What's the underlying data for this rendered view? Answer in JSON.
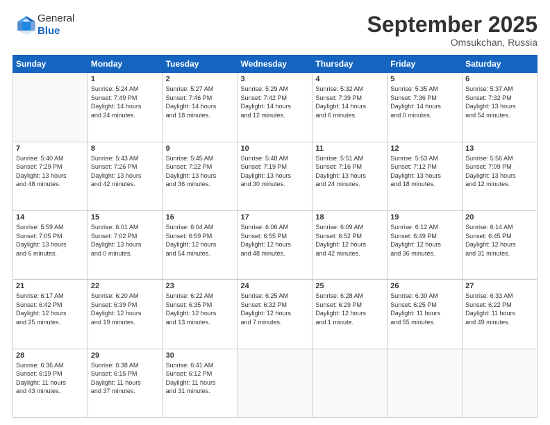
{
  "header": {
    "logo_general": "General",
    "logo_blue": "Blue",
    "month": "September 2025",
    "location": "Omsukchan, Russia"
  },
  "weekdays": [
    "Sunday",
    "Monday",
    "Tuesday",
    "Wednesday",
    "Thursday",
    "Friday",
    "Saturday"
  ],
  "weeks": [
    [
      {
        "day": "",
        "info": ""
      },
      {
        "day": "1",
        "info": "Sunrise: 5:24 AM\nSunset: 7:49 PM\nDaylight: 14 hours\nand 24 minutes."
      },
      {
        "day": "2",
        "info": "Sunrise: 5:27 AM\nSunset: 7:46 PM\nDaylight: 14 hours\nand 18 minutes."
      },
      {
        "day": "3",
        "info": "Sunrise: 5:29 AM\nSunset: 7:42 PM\nDaylight: 14 hours\nand 12 minutes."
      },
      {
        "day": "4",
        "info": "Sunrise: 5:32 AM\nSunset: 7:39 PM\nDaylight: 14 hours\nand 6 minutes."
      },
      {
        "day": "5",
        "info": "Sunrise: 5:35 AM\nSunset: 7:36 PM\nDaylight: 14 hours\nand 0 minutes."
      },
      {
        "day": "6",
        "info": "Sunrise: 5:37 AM\nSunset: 7:32 PM\nDaylight: 13 hours\nand 54 minutes."
      }
    ],
    [
      {
        "day": "7",
        "info": "Sunrise: 5:40 AM\nSunset: 7:29 PM\nDaylight: 13 hours\nand 48 minutes."
      },
      {
        "day": "8",
        "info": "Sunrise: 5:43 AM\nSunset: 7:26 PM\nDaylight: 13 hours\nand 42 minutes."
      },
      {
        "day": "9",
        "info": "Sunrise: 5:45 AM\nSunset: 7:22 PM\nDaylight: 13 hours\nand 36 minutes."
      },
      {
        "day": "10",
        "info": "Sunrise: 5:48 AM\nSunset: 7:19 PM\nDaylight: 13 hours\nand 30 minutes."
      },
      {
        "day": "11",
        "info": "Sunrise: 5:51 AM\nSunset: 7:16 PM\nDaylight: 13 hours\nand 24 minutes."
      },
      {
        "day": "12",
        "info": "Sunrise: 5:53 AM\nSunset: 7:12 PM\nDaylight: 13 hours\nand 18 minutes."
      },
      {
        "day": "13",
        "info": "Sunrise: 5:56 AM\nSunset: 7:09 PM\nDaylight: 13 hours\nand 12 minutes."
      }
    ],
    [
      {
        "day": "14",
        "info": "Sunrise: 5:59 AM\nSunset: 7:05 PM\nDaylight: 13 hours\nand 6 minutes."
      },
      {
        "day": "15",
        "info": "Sunrise: 6:01 AM\nSunset: 7:02 PM\nDaylight: 13 hours\nand 0 minutes."
      },
      {
        "day": "16",
        "info": "Sunrise: 6:04 AM\nSunset: 6:59 PM\nDaylight: 12 hours\nand 54 minutes."
      },
      {
        "day": "17",
        "info": "Sunrise: 6:06 AM\nSunset: 6:55 PM\nDaylight: 12 hours\nand 48 minutes."
      },
      {
        "day": "18",
        "info": "Sunrise: 6:09 AM\nSunset: 6:52 PM\nDaylight: 12 hours\nand 42 minutes."
      },
      {
        "day": "19",
        "info": "Sunrise: 6:12 AM\nSunset: 6:49 PM\nDaylight: 12 hours\nand 36 minutes."
      },
      {
        "day": "20",
        "info": "Sunrise: 6:14 AM\nSunset: 6:45 PM\nDaylight: 12 hours\nand 31 minutes."
      }
    ],
    [
      {
        "day": "21",
        "info": "Sunrise: 6:17 AM\nSunset: 6:42 PM\nDaylight: 12 hours\nand 25 minutes."
      },
      {
        "day": "22",
        "info": "Sunrise: 6:20 AM\nSunset: 6:39 PM\nDaylight: 12 hours\nand 19 minutes."
      },
      {
        "day": "23",
        "info": "Sunrise: 6:22 AM\nSunset: 6:35 PM\nDaylight: 12 hours\nand 13 minutes."
      },
      {
        "day": "24",
        "info": "Sunrise: 6:25 AM\nSunset: 6:32 PM\nDaylight: 12 hours\nand 7 minutes."
      },
      {
        "day": "25",
        "info": "Sunrise: 6:28 AM\nSunset: 6:29 PM\nDaylight: 12 hours\nand 1 minute."
      },
      {
        "day": "26",
        "info": "Sunrise: 6:30 AM\nSunset: 6:25 PM\nDaylight: 11 hours\nand 55 minutes."
      },
      {
        "day": "27",
        "info": "Sunrise: 6:33 AM\nSunset: 6:22 PM\nDaylight: 11 hours\nand 49 minutes."
      }
    ],
    [
      {
        "day": "28",
        "info": "Sunrise: 6:36 AM\nSunset: 6:19 PM\nDaylight: 11 hours\nand 43 minutes."
      },
      {
        "day": "29",
        "info": "Sunrise: 6:38 AM\nSunset: 6:15 PM\nDaylight: 11 hours\nand 37 minutes."
      },
      {
        "day": "30",
        "info": "Sunrise: 6:41 AM\nSunset: 6:12 PM\nDaylight: 11 hours\nand 31 minutes."
      },
      {
        "day": "",
        "info": ""
      },
      {
        "day": "",
        "info": ""
      },
      {
        "day": "",
        "info": ""
      },
      {
        "day": "",
        "info": ""
      }
    ]
  ]
}
